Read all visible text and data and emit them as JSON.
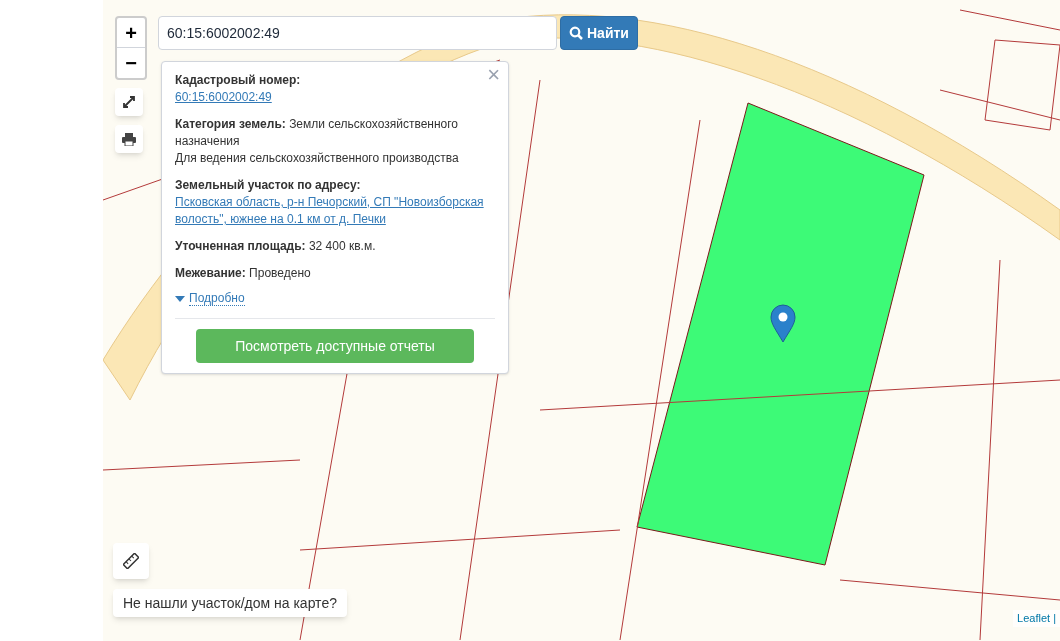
{
  "zoom_controls": [
    "+",
    "−"
  ],
  "search": {
    "value": "60:15:6002002:49",
    "button": "Найти"
  },
  "popup": {
    "close": "×",
    "fields": [
      {
        "label": "Кадастровый номер:",
        "value": "60:15:6002002:49",
        "kind": "link"
      },
      {
        "label": "Категория земель:",
        "value": "Земли сельскохозяйственного назначения",
        "kind": "text",
        "extra": "Для ведения сельскохозяйственного производства"
      },
      {
        "label": "Земельный участок по адресу:",
        "value": "Псковская область, р-н Печорский, СП \"Новоизборская волость\", южнее на 0.1 км от д. Печки",
        "kind": "link"
      },
      {
        "label": "Уточненная площадь:",
        "value": "32 400 кв.м.",
        "kind": "text"
      },
      {
        "label": "Межевание:",
        "value": "Проведено",
        "kind": "text"
      }
    ],
    "details": {
      "label": "Подробно",
      "expanded": false
    },
    "report_button": "Посмотреть доступные отчеты"
  },
  "not_found_button": "Не нашли участок/дом на карте?",
  "attribution": "Leaflet |"
}
